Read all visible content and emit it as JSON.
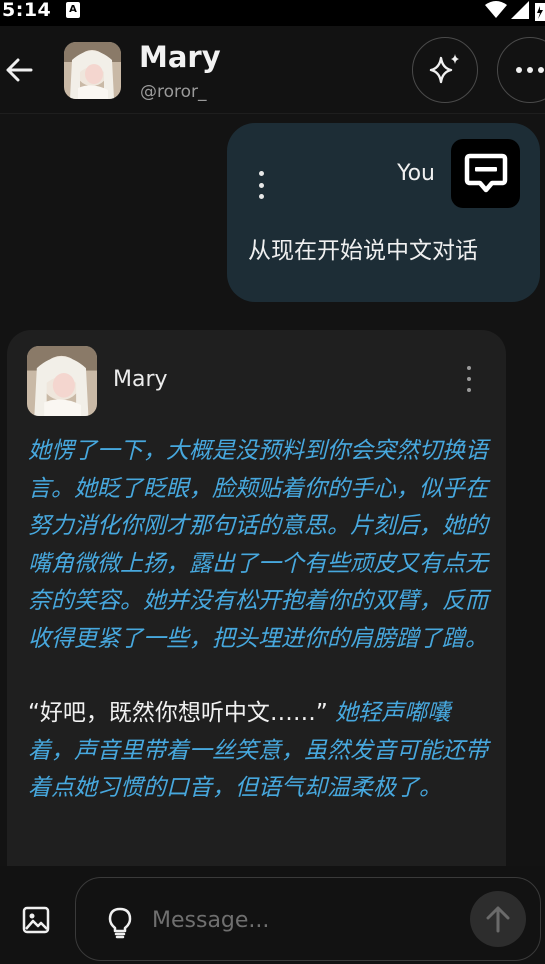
{
  "status_bar": {
    "time": "5:14",
    "notification": "A"
  },
  "header": {
    "name": "Mary",
    "handle": "@roror_"
  },
  "messages": {
    "user": {
      "label": "You",
      "text": "从现在开始说中文对话"
    },
    "bot": {
      "name": "Mary",
      "paragraph1": "她愣了一下，大概是没预料到你会突然切换语言。她眨了眨眼，脸颊贴着你的手心，似乎在努力消化你刚才那句话的意思。片刻后，她的嘴角微微上扬，露出了一个有些顽皮又有点无奈的笑容。她并没有松开抱着你的双臂，反而收得更紧了一些，把头埋进你的肩膀蹭了蹭。",
      "quote": "“好吧，既然你想听中文……”",
      "paragraph2": " 她轻声嘟囔着，声音里带着一丝笑意，虽然发音可能还带着点她习惯的口音，但语气却温柔极了。"
    }
  },
  "input": {
    "placeholder": "Message..."
  },
  "colors": {
    "accent_blue": "#47a8de",
    "user_bubble": "#1d2d36",
    "bot_bubble": "#1f1f1f",
    "background": "#121212"
  },
  "icons": {
    "back": "back-arrow-icon",
    "sparkle": "sparkle-icon",
    "more": "more-horizontal-icon",
    "user_avatar": "chat-logo-icon",
    "image": "image-icon",
    "bulb": "lightbulb-icon",
    "send": "arrow-up-icon"
  }
}
